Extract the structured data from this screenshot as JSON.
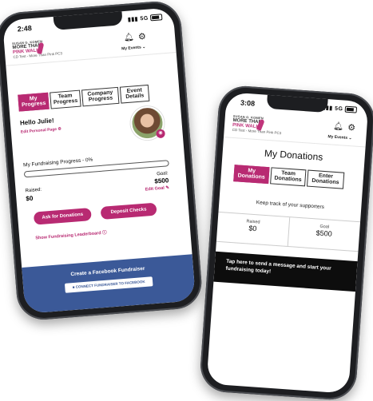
{
  "phone_left": {
    "status": {
      "time": "2:48",
      "signal": "5G"
    },
    "header": {
      "logo_top": "SUSAN G. KOMEN",
      "logo_line1": "MORE THAN",
      "logo_line2": "PINK WALK",
      "event": "CD Test - More Than Pink PC3",
      "my_events": "My Events"
    },
    "tabs": [
      {
        "label": "My Progress"
      },
      {
        "label": "Team Progress"
      },
      {
        "label": "Company Progress"
      },
      {
        "label": "Event Details"
      }
    ],
    "greeting": "Hello Julie!",
    "edit_page": "Edit Personal Page",
    "progress_title": "My Fundraising Progress - 0%",
    "progress_fraction": 0,
    "raised_label": "Raised:",
    "raised_value": "$0",
    "goal_label": "Goal:",
    "goal_value": "$500",
    "edit_goal": "Edit Goal",
    "buttons": {
      "ask": "Ask for Donations",
      "deposit": "Deposit Checks"
    },
    "leaderboard": "Show Fundraising Leaderboard",
    "facebook": {
      "title": "Create a Facebook Fundraiser",
      "connect": "CONNECT FUNDRAISER TO FACEBOOK"
    }
  },
  "phone_right": {
    "status": {
      "time": "3:08",
      "signal": "5G"
    },
    "header": {
      "logo_top": "SUSAN G. KOMEN",
      "logo_line1": "MORE THAN",
      "logo_line2": "PINK WALK",
      "event": "CD Test - More Than Pink PC3",
      "my_events": "My Events"
    },
    "title": "My Donations",
    "tabs": [
      {
        "label": "My Donations"
      },
      {
        "label": "Team Donations"
      },
      {
        "label": "Enter Donations"
      }
    ],
    "subtitle": "Keep track of your supporters",
    "raised_label": "Raised",
    "raised_value": "$0",
    "goal_label": "Goal",
    "goal_value": "$500",
    "message": "Tap here to send a message and start your fundraising today!"
  },
  "colors": {
    "brand_pink": "#b82a72",
    "facebook_blue": "#3b5998",
    "dark_banner": "#0d0d0d"
  }
}
